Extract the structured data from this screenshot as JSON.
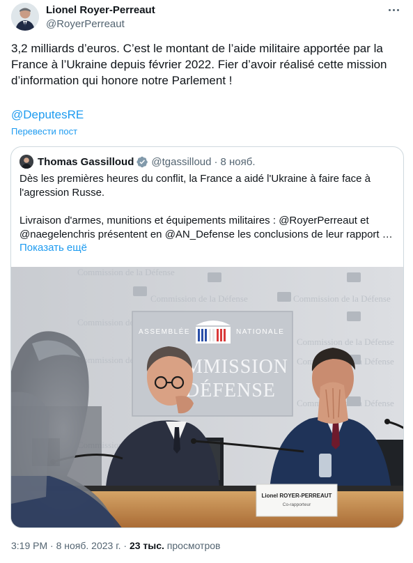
{
  "author": {
    "name": "Lionel Royer-Perreaut",
    "handle": "@RoyerPerreaut"
  },
  "tweet": {
    "text": "3,2 milliards d’euros. C’est le montant de l’aide militaire apportée par la France à l’Ukraine depuis février 2022. Fier d’avoir réalisé cette mission d’information qui honore notre Parlement !",
    "mention": "@DeputesRE",
    "translate_label": "Перевести пост"
  },
  "quoted": {
    "name": "Thomas Gassilloud",
    "handle": "@tgassilloud",
    "separator": "·",
    "date": "8 нояб.",
    "para1": "Dès les premières heures du conflit, la France a aidé l'Ukraine à faire face à l'agression Russe.",
    "para2": "Livraison d'armes, munitions et équipements militaires : @RoyerPerreaut et @naegelenchris présentent en @AN_Defense les conclusions de leur rapport …",
    "show_more": "Показать ещё",
    "photo": {
      "wall_text": "Commission de la Défense",
      "sign_top_left": "ASSEMBLÉE",
      "sign_top_right": "NATIONALE",
      "sign_line1": "MMISSION",
      "sign_line2": "DÉFENSE",
      "nameplate_name": "Lionel ROYER-PERREAUT",
      "nameplate_role": "Co-rapporteur"
    }
  },
  "footer": {
    "time": "3:19 PM",
    "sep1": "·",
    "date": "8 нояб. 2023 г.",
    "sep2": "·",
    "views_count": "23 тыс.",
    "views_label": "просмотров"
  },
  "colors": {
    "accent": "#1d9bf0",
    "text": "#0f1419",
    "muted": "#536471",
    "border": "#cfd9de"
  }
}
